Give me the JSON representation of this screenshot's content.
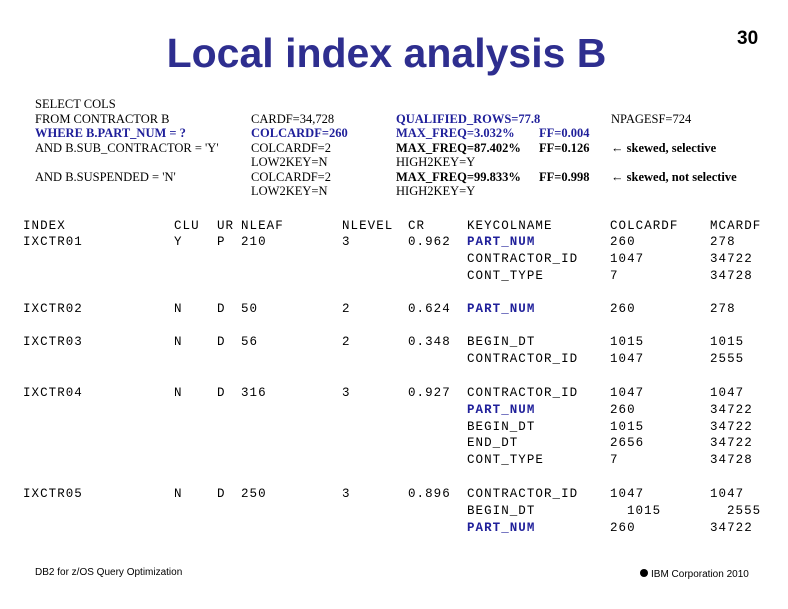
{
  "title": "Local index analysis B",
  "page_number": "30",
  "query": {
    "lines": [
      "SELECT COLS",
      "FROM CONTRACTOR B",
      "WHERE B.PART_NUM = ?",
      "AND B.SUB_CONTRACTOR = 'Y'",
      "AND B.SUSPENDED = 'N'"
    ]
  },
  "stats": {
    "cardf": "CARDF=34,728",
    "colcardf_part": "COLCARDF=260",
    "colcardf_sub": "COLCARDF=2",
    "low2key_sub": "LOW2KEY=N",
    "colcardf_susp": "COLCARDF=2",
    "low2key_susp": "LOW2KEY=N",
    "qualified_rows": "QUALIFIED_ROWS=77.8",
    "max_freq_part": "MAX_FREQ=3.032%",
    "max_freq_sub": "MAX_FREQ=87.402%",
    "high2key_sub": "HIGH2KEY=Y",
    "max_freq_susp": "MAX_FREQ=99.833%",
    "high2key_susp": "HIGH2KEY=Y",
    "ff_part": "FF=0.004",
    "ff_sub": "FF=0.126",
    "ff_susp": "FF=0.998",
    "npagesf": "NPAGESF=724",
    "note_sub": "skewed, selective",
    "note_susp": "skewed, not selective"
  },
  "table": {
    "headers": [
      "INDEX",
      "CLU",
      "UR",
      "NLEAF",
      "NLEVEL",
      "CR",
      "KEYCOLNAME",
      "COLCARDF",
      "MCARDF"
    ],
    "rows": [
      {
        "index": "IXCTR01",
        "clu": "Y",
        "ur": "P",
        "nleaf": "210",
        "nlevel": "3",
        "cr": "0.962",
        "keys": [
          {
            "name": "PART_NUM",
            "colcardf": "260",
            "mcardf": "278",
            "highlight": true
          },
          {
            "name": "CONTRACTOR_ID",
            "colcardf": "1047",
            "mcardf": "34722"
          },
          {
            "name": "CONT_TYPE",
            "colcardf": "7",
            "mcardf": "34728"
          }
        ]
      },
      {
        "index": "IXCTR02",
        "clu": "N",
        "ur": "D",
        "nleaf": "50",
        "nlevel": "2",
        "cr": "0.624",
        "keys": [
          {
            "name": "PART_NUM",
            "colcardf": "260",
            "mcardf": "278",
            "highlight": true
          }
        ]
      },
      {
        "index": "IXCTR03",
        "clu": "N",
        "ur": "D",
        "nleaf": "56",
        "nlevel": "2",
        "cr": "0.348",
        "keys": [
          {
            "name": "BEGIN_DT",
            "colcardf": "1015",
            "mcardf": "1015"
          },
          {
            "name": "CONTRACTOR_ID",
            "colcardf": "1047",
            "mcardf": "2555"
          }
        ]
      },
      {
        "index": "IXCTR04",
        "clu": "N",
        "ur": "D",
        "nleaf": "316",
        "nlevel": "3",
        "cr": "0.927",
        "keys": [
          {
            "name": "CONTRACTOR_ID",
            "colcardf": "1047",
            "mcardf": "1047"
          },
          {
            "name": "PART_NUM",
            "colcardf": "260",
            "mcardf": "34722",
            "highlight": true
          },
          {
            "name": "BEGIN_DT",
            "colcardf": "1015",
            "mcardf": "34722"
          },
          {
            "name": "END_DT",
            "colcardf": "2656",
            "mcardf": "34722"
          },
          {
            "name": "CONT_TYPE",
            "colcardf": "7",
            "mcardf": "34728"
          }
        ]
      },
      {
        "index": "IXCTR05",
        "clu": "N",
        "ur": "D",
        "nleaf": "250",
        "nlevel": "3",
        "cr": "0.896",
        "keys": [
          {
            "name": "CONTRACTOR_ID",
            "colcardf": "1047",
            "mcardf": "1047"
          },
          {
            "name": "BEGIN_DT",
            "colcardf": "1015",
            "mcardf": "2555",
            "shift": true
          },
          {
            "name": "PART_NUM",
            "colcardf": "260",
            "mcardf": "34722",
            "highlight": true
          }
        ]
      }
    ]
  },
  "footer": {
    "left": "DB2 for z/OS Query Optimization",
    "right": "IBM Corporation 2010"
  }
}
